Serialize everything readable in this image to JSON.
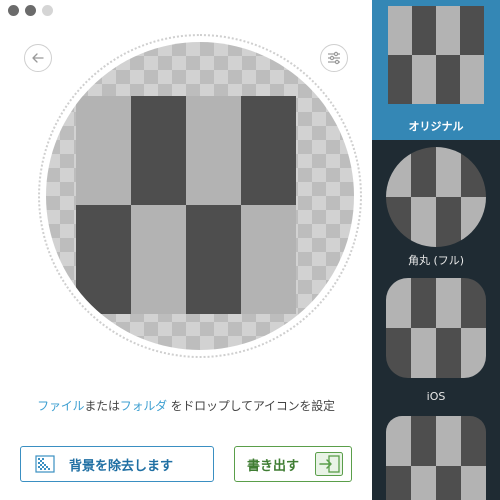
{
  "window": {
    "traffic_lights": [
      "close",
      "minimize",
      "zoom"
    ]
  },
  "toolbar": {
    "back_icon": "arrow-left-icon",
    "settings_icon": "sliders-icon"
  },
  "drop_zone": {
    "pattern": {
      "light": "#b3b3b3",
      "dark": "#4e4e4e"
    }
  },
  "instruction": {
    "part1": "ファイル",
    "part2": "または",
    "part3": "フォルダ",
    "part4": " をドロップしてアイコンを設定"
  },
  "buttons": {
    "remove_bg_label": "背景を除去します",
    "export_label": "書き出す"
  },
  "sidebar": {
    "selected_color": "#3487b5",
    "previews": [
      {
        "label": "オリジナル",
        "selected": true
      },
      {
        "label": "角丸 (フル)",
        "selected": false
      },
      {
        "label": "iOS",
        "selected": false
      },
      {
        "label": "",
        "selected": false
      }
    ]
  },
  "colors": {
    "link": "#3d9fd1",
    "remove_border": "#3a8fc2",
    "export_border": "#5a9e4a",
    "sidebar_bg": "#1f2b33"
  }
}
